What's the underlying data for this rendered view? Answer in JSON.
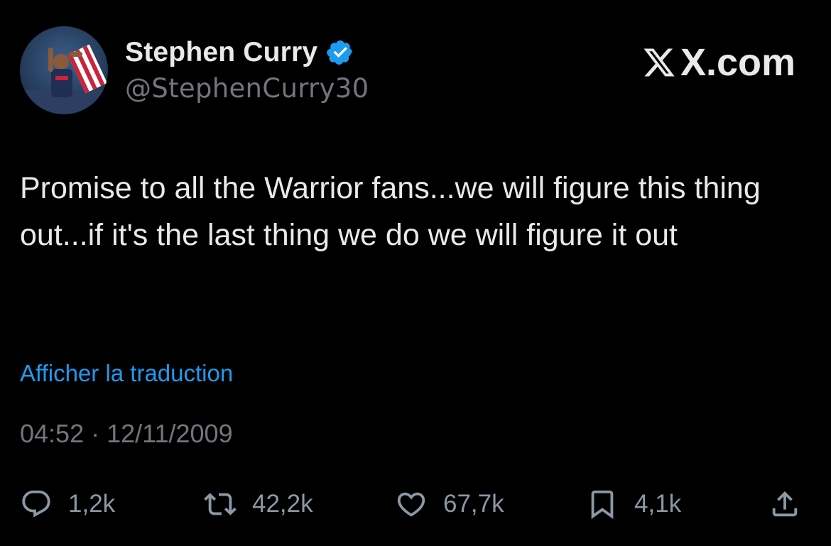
{
  "author": {
    "display_name": "Stephen Curry",
    "handle": "@StephenCurry30",
    "verified_icon": "verified-badge-icon",
    "avatar_icon": "avatar-photo"
  },
  "brand": {
    "text": "X.com",
    "icon": "x-logo-icon"
  },
  "tweet": {
    "text": "Promise to all the Warrior fans...we will figure this thing out...if it's the last thing we do we will figure it out",
    "translate_label": "Afficher la traduction",
    "timestamp": "04:52 · 12/11/2009"
  },
  "actions": {
    "reply": {
      "icon": "reply-icon",
      "count": "1,2k"
    },
    "retweet": {
      "icon": "retweet-icon",
      "count": "42,2k"
    },
    "like": {
      "icon": "heart-icon",
      "count": "67,7k"
    },
    "bookmark": {
      "icon": "bookmark-icon",
      "count": "4,1k"
    },
    "share": {
      "icon": "share-icon"
    }
  },
  "colors": {
    "background": "#000000",
    "text": "#e7e9ea",
    "secondary": "#71767b",
    "link": "#1d9bf0",
    "verified": "#1d9bf0",
    "icons": "#8b98a5"
  }
}
